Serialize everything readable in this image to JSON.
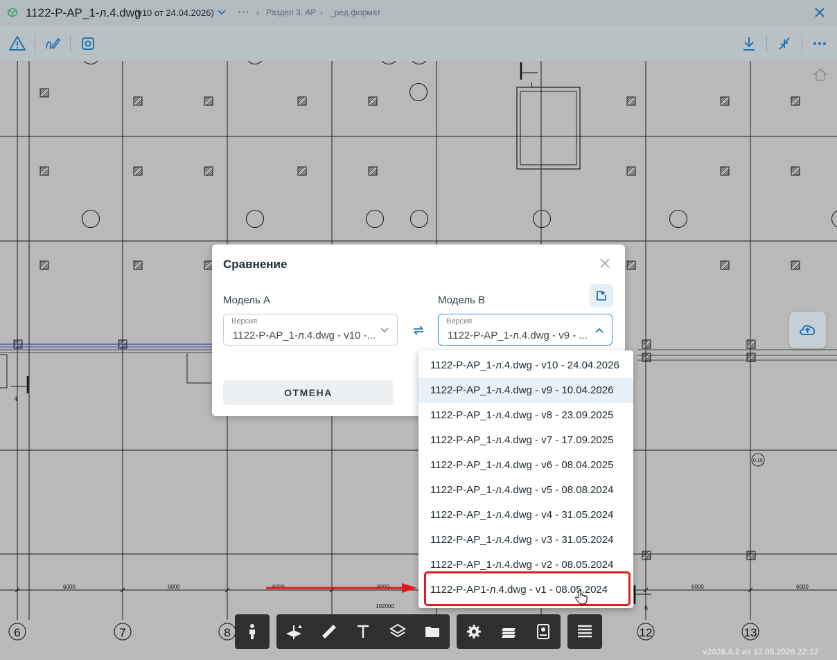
{
  "header": {
    "file_title": "1122-Р-АР_1-л.4.dwg",
    "version_info": "(v10 от 24.04.2026)",
    "more_label": "···",
    "breadcrumb": [
      {
        "label": "Раздел 3. АР"
      },
      {
        "label": "_ред.формат"
      }
    ]
  },
  "toolbar": {
    "left_icons": [
      "warning-icon",
      "markup-pen-icon",
      "screenshot-icon"
    ],
    "right_icons": [
      "download-icon",
      "compare-icon",
      "more-icon"
    ]
  },
  "drawing": {
    "axes": [
      "6",
      "7",
      "8",
      "12",
      "13"
    ],
    "dimension_labels": [
      "6000",
      "6000",
      "6000",
      "6000",
      "6000",
      "6000",
      "6000"
    ],
    "total_dimension": "102000",
    "section_marks": [
      "1",
      "4",
      "6"
    ],
    "level_mark": "0.15"
  },
  "dialog": {
    "title": "Сравнение",
    "model_a": {
      "label": "Модель A",
      "caption": "Версия",
      "value": "1122-Р-АР_1-л.4.dwg - v10 -..."
    },
    "model_b": {
      "label": "Модель B",
      "caption": "Версия",
      "value": "1122-Р-АР_1-л.4.dwg - v9 - ..."
    },
    "cancel_label": "ОТМЕНА"
  },
  "dropdown": {
    "options": [
      "1122-Р-АР_1-л.4.dwg - v10 - 24.04.2026",
      "1122-Р-АР_1-л.4.dwg - v9 - 10.04.2026",
      "1122-Р-АР_1-л.4.dwg - v8 - 23.09.2025",
      "1122-Р-АР_1-л.4.dwg - v7 - 17.09.2025",
      "1122-Р-АР_1-л.4.dwg - v6 - 08.04.2025",
      "1122-Р-АР_1-л.4.dwg - v5 - 08.08.2024",
      "1122-Р-АР_1-л.4.dwg - v4 - 31.05.2024",
      "1122-Р-АР_1-л.4.dwg - v3 - 31.05.2024",
      "1122-Р-АР_1-л.4.dwg - v2 - 08.05.2024",
      "1122-Р-АР1-л.4.dwg - v1 - 08.05.2024"
    ],
    "selected_index": 1,
    "annotated_index": 9
  },
  "bottom_toolbar": {
    "groups": [
      [
        "person-icon"
      ],
      [
        "section-plane-icon",
        "ruler-icon",
        "text-icon",
        "layers-icon",
        "folder-icon"
      ],
      [
        "settings-icon",
        "sheets-icon",
        "badge-icon"
      ],
      [
        "list-icon"
      ]
    ]
  },
  "footer": {
    "version_text": "v2026.8.2 из 12.05.2026 22:12"
  },
  "colors": {
    "accent": "#3a8fd6",
    "annotation": "#e11a1a",
    "toolbar_bg": "#b3bbbf",
    "icon_blue": "#1f74b8"
  }
}
